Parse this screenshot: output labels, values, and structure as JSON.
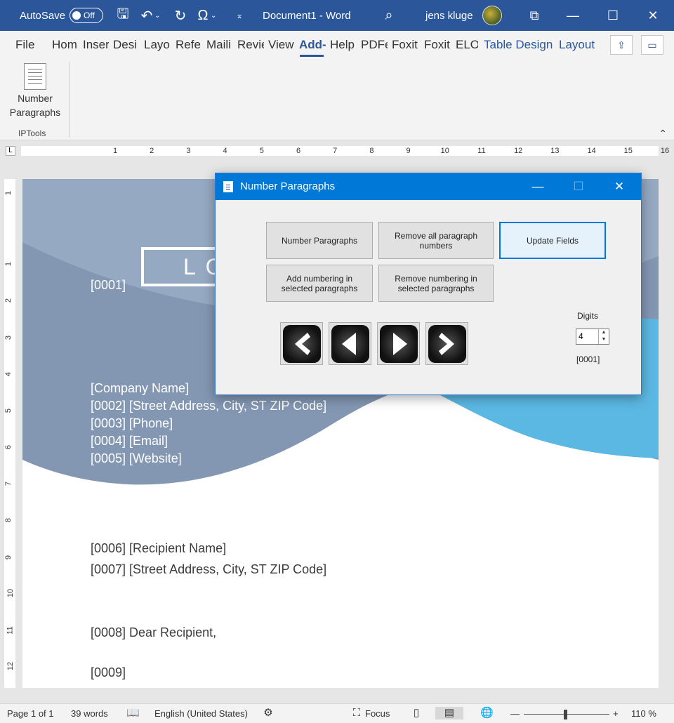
{
  "titlebar": {
    "autosave_label": "AutoSave",
    "autosave_state": "Off",
    "document_title": "Document1  -  Word",
    "user_name": "jens kluge"
  },
  "ribbon": {
    "tabs": [
      "File",
      "Hom",
      "Inser",
      "Desi",
      "Layo",
      "Refe",
      "Maili",
      "Revie",
      "View",
      "Add-",
      "Help",
      "PDFe",
      "Foxit",
      "Foxit",
      "ELO"
    ],
    "context_tabs": [
      "Table Design",
      "Layout"
    ],
    "active_tab": "Add-",
    "button_line1": "Number",
    "button_line2": "Paragraphs",
    "group_label": "IPTools"
  },
  "ruler": {
    "numbers": [
      "1",
      "2",
      "3",
      "4",
      "5",
      "6",
      "7",
      "8",
      "9",
      "10",
      "11",
      "12",
      "13",
      "14",
      "15",
      "16"
    ],
    "vertical_numbers": [
      "1",
      "1",
      "2",
      "3",
      "4",
      "5",
      "6",
      "7",
      "8",
      "9",
      "10",
      "11",
      "12"
    ]
  },
  "document": {
    "logo_text": "LO",
    "lines": {
      "l0001": "[0001]",
      "company": "[Company Name]",
      "street": "[0002] [Street Address, City, ST ZIP Code]",
      "phone": "[0003] [Phone]",
      "email": "[0004] [Email]",
      "website": "[0005] [Website]",
      "recipient": "[0006] [Recipient Name]",
      "rstreet": "[0007] [Street Address, City, ST ZIP Code]",
      "dear": "[0008] Dear Recipient,",
      "l0009": "[0009]"
    },
    "colors": {
      "wave_dark": "#8397b3",
      "wave_light": "#5bb8e3",
      "text": "#3c3c3c"
    }
  },
  "dialog": {
    "title": "Number Paragraphs",
    "buttons": {
      "number": "Number Paragraphs",
      "remove_all": "Remove all paragraph numbers",
      "update": "Update Fields",
      "add_selected": "Add numbering in selected paragraphs",
      "remove_selected": "Remove numbering in selected paragraphs"
    },
    "digits_label": "Digits",
    "digits_value": "4",
    "preview": "[0001]"
  },
  "statusbar": {
    "page": "Page 1 of 1",
    "words": "39 words",
    "language": "English (United States)",
    "focus": "Focus",
    "zoom_minus": "—",
    "zoom_plus": "+",
    "zoom": "110 %"
  },
  "accent": "#2b579a"
}
